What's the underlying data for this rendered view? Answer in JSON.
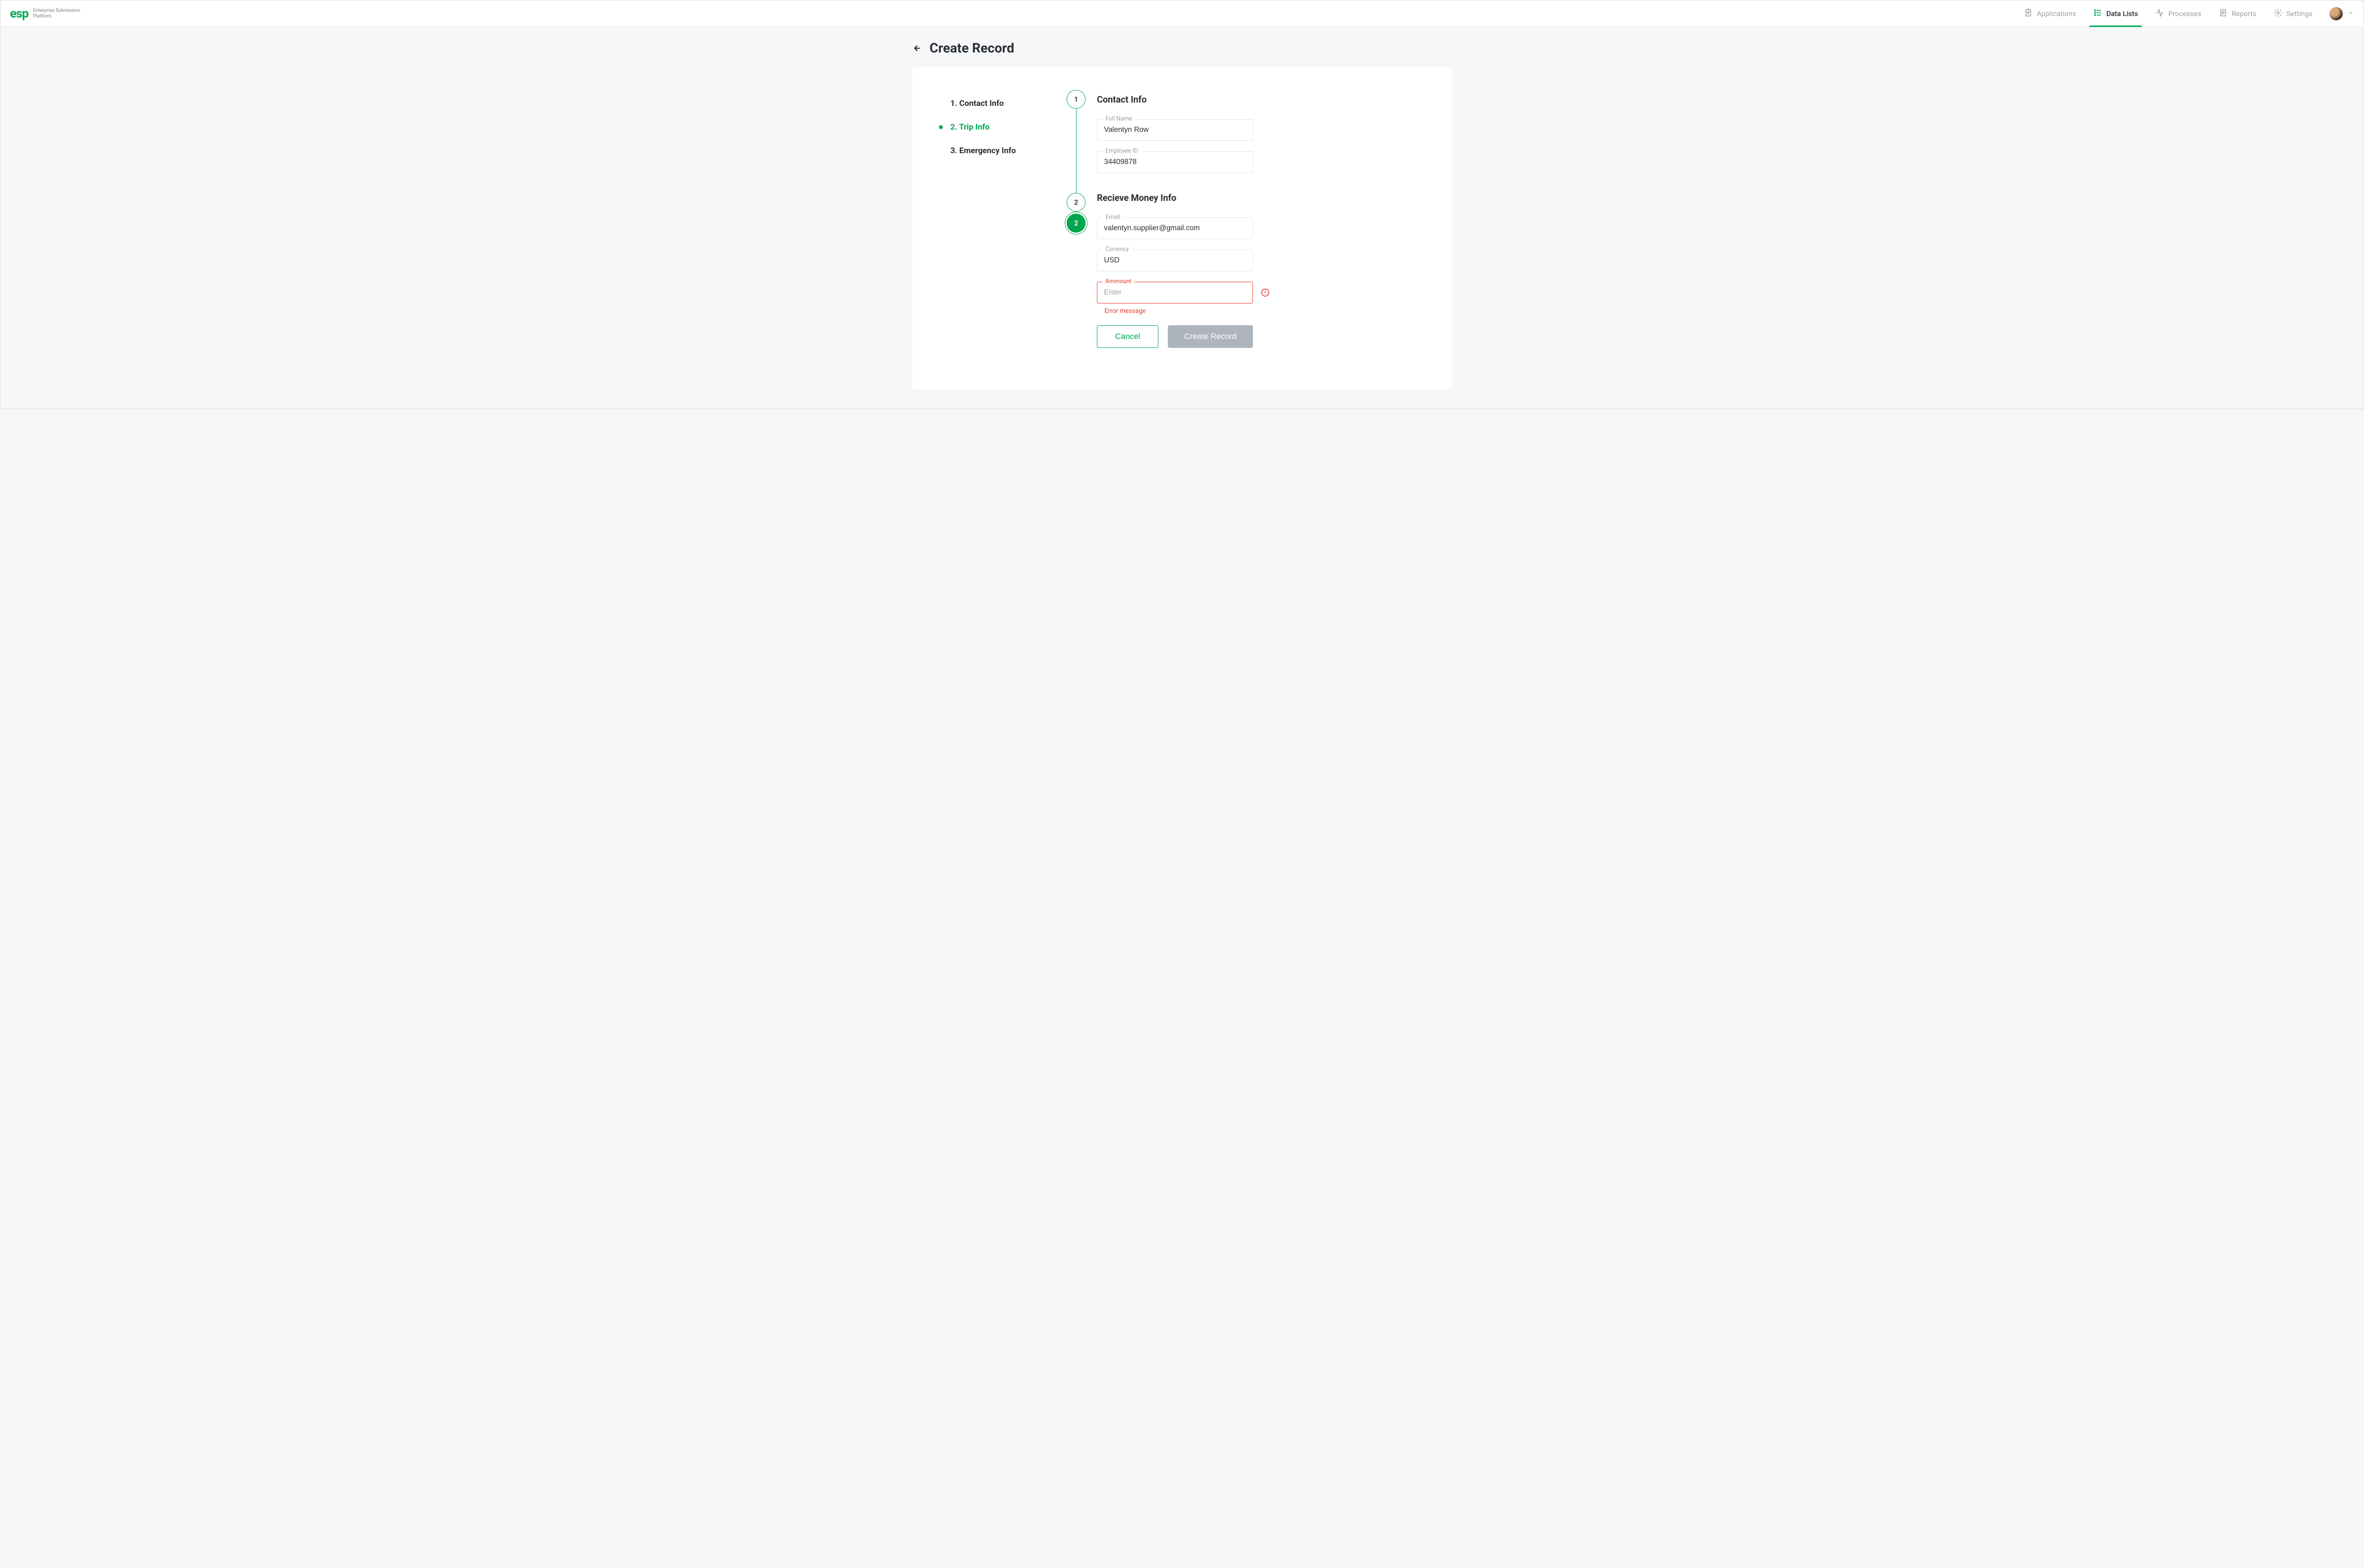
{
  "header": {
    "brand_logo": "esp",
    "brand_sub_line1": "Enterprise Submission",
    "brand_sub_line2": "Platform",
    "nav": [
      {
        "key": "applications",
        "label": "Applications",
        "active": false
      },
      {
        "key": "data-lists",
        "label": "Data Lists",
        "active": true
      },
      {
        "key": "processes",
        "label": "Processes",
        "active": false
      },
      {
        "key": "reports",
        "label": "Reports",
        "active": false
      },
      {
        "key": "settings",
        "label": "Settings",
        "active": false
      }
    ]
  },
  "page": {
    "title": "Create Record"
  },
  "side_steps": [
    {
      "label": "1. Contact Info",
      "active": false
    },
    {
      "label": "2. Trip Info",
      "active": true
    },
    {
      "label": "3. Emergency Info",
      "active": false
    }
  ],
  "timeline": {
    "step1_num": "1",
    "step2_num": "2",
    "step2b_num": "2"
  },
  "form": {
    "section1": {
      "title": "Contact Info",
      "full_name_label": "Full Name",
      "full_name_value": "Valentyn Row",
      "employee_id_label": "Employee ID",
      "employee_id_value": "34409878"
    },
    "section2": {
      "title": "Recieve Money Info",
      "email_label": "Email",
      "email_value": "valentyn.supplier@gmail.com",
      "currency_label": "Currency",
      "currency_value": "USD",
      "amount_label": "Ammount",
      "amount_value": "",
      "amount_placeholder": "Enter",
      "amount_error": "Error message"
    }
  },
  "actions": {
    "cancel": "Cancel",
    "submit": "Create Record"
  },
  "colors": {
    "accent": "#00a64f",
    "error": "#e33b2e"
  }
}
